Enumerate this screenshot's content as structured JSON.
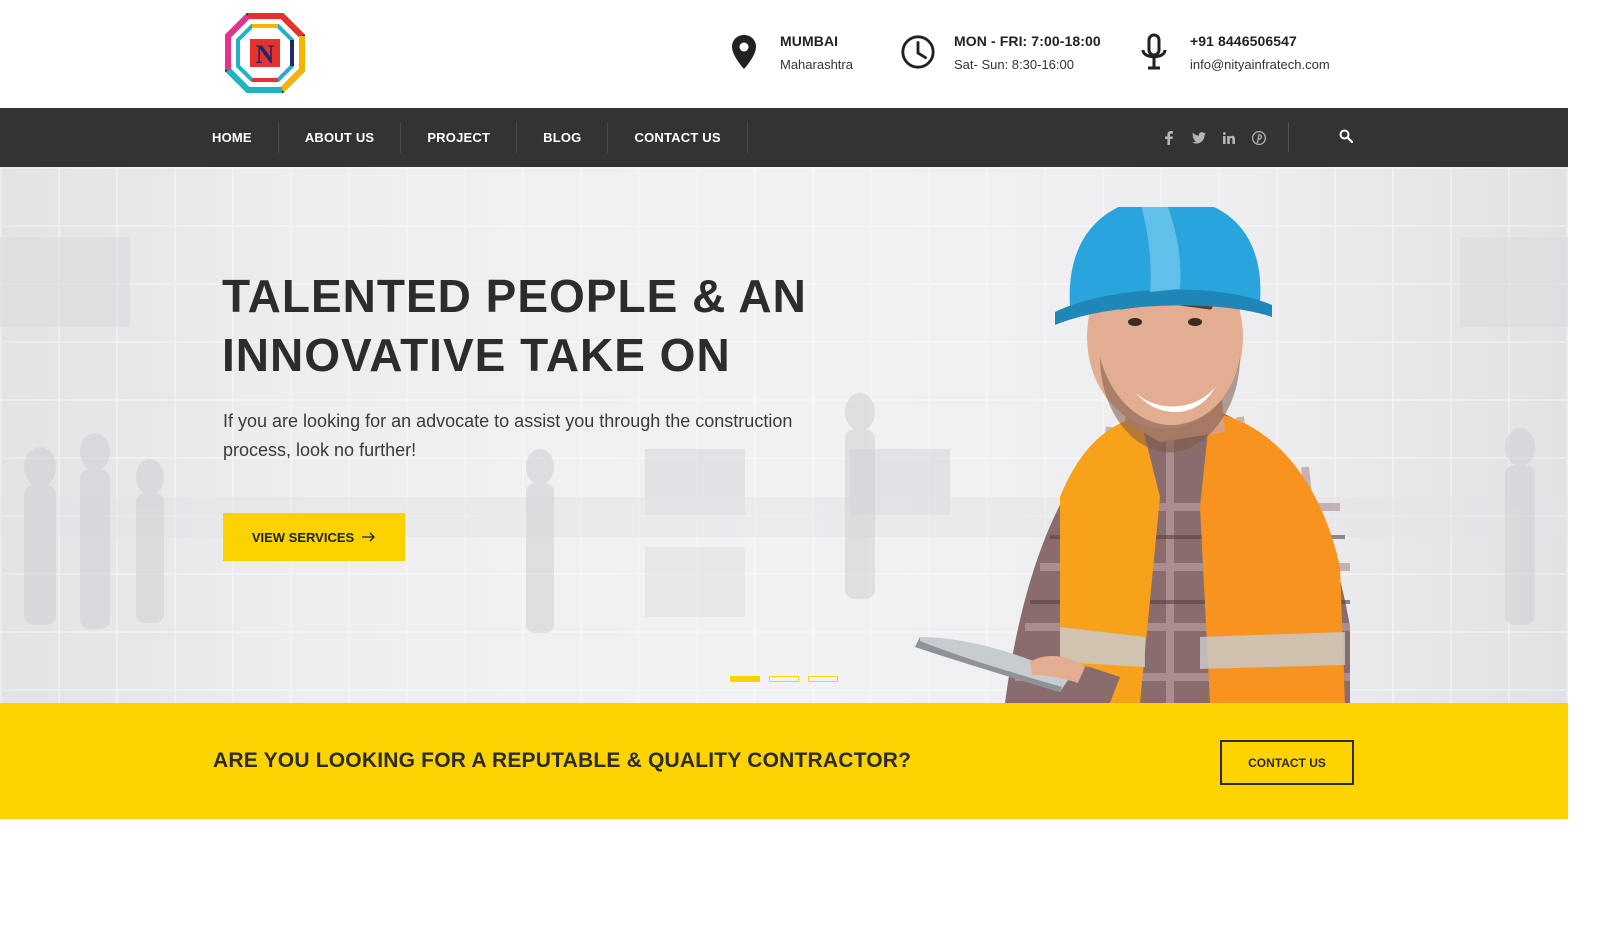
{
  "header": {
    "logo_letter": "N",
    "info": [
      {
        "icon": "map-pin-icon",
        "title": "MUMBAI",
        "text": "Maharashtra"
      },
      {
        "icon": "clock-icon",
        "title": "MON - FRI: 7:00-18:00",
        "text": "Sat- Sun: 8:30-16:00"
      },
      {
        "icon": "microphone-icon",
        "title": "+91 8446506547",
        "text": "info@nityainfratech.com"
      }
    ]
  },
  "nav": {
    "items": [
      "HOME",
      "ABOUT US",
      "PROJECT",
      "BLOG",
      "CONTACT US"
    ],
    "social": [
      {
        "icon": "facebook-icon",
        "glyph": "f"
      },
      {
        "icon": "twitter-icon",
        "glyph": ""
      },
      {
        "icon": "linkedin-icon",
        "glyph": "in"
      },
      {
        "icon": "pinterest-icon",
        "glyph": ""
      }
    ],
    "search_icon": "search-icon"
  },
  "hero": {
    "title_line1": "TALENTED PEOPLE & AN",
    "title_line2": "INNOVATIVE TAKE ON",
    "subtitle": "If you are looking for an advocate to assist you through the construction process, look no further!",
    "button_label": "VIEW SERVICES",
    "slides": 3,
    "active_slide": 1
  },
  "cta": {
    "text": "ARE YOU LOOKING FOR A REPUTABLE & QUALITY CONTRACTOR?",
    "button_label": "CONTACT US"
  },
  "colors": {
    "accent": "#fcd200",
    "nav_bg": "#333333",
    "dark_text": "#2b2b2b"
  }
}
